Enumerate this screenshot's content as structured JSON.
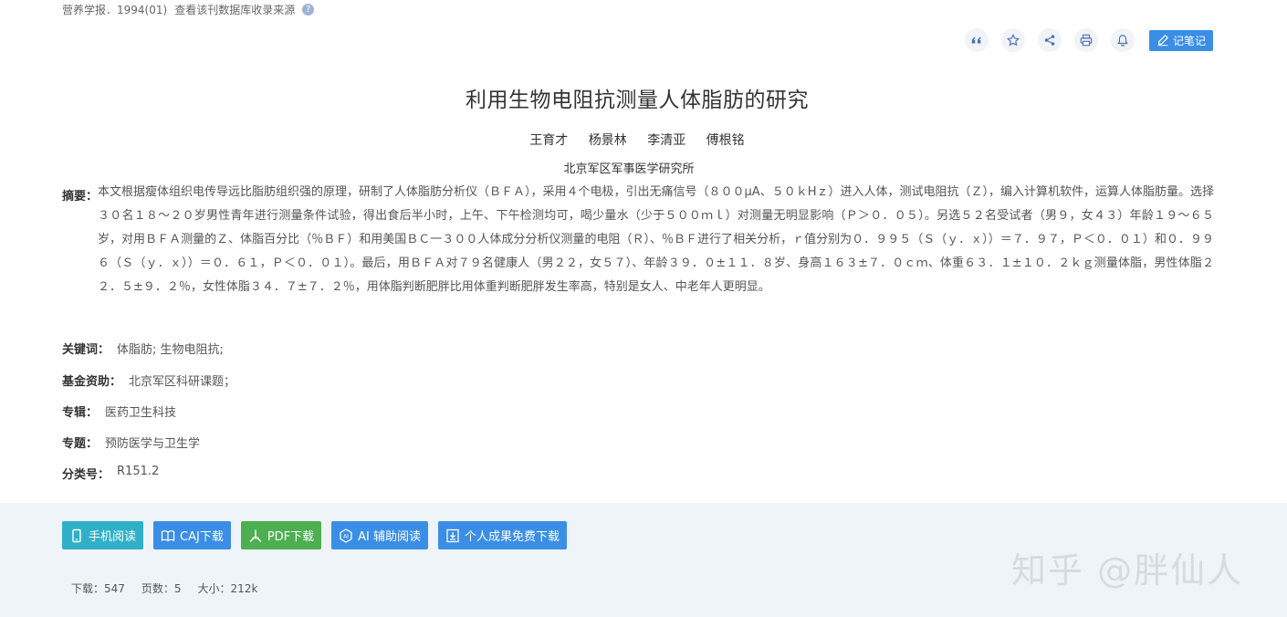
{
  "source": {
    "journal": "营养学报．1994(01)",
    "link": "查看该刊数据库收录来源"
  },
  "toolbar": {
    "buttons": [
      "quote-icon",
      "star-icon",
      "share-icon",
      "print-icon",
      "bell-icon"
    ],
    "note_label": "记笔记"
  },
  "article": {
    "title": "利用生物电阻抗测量人体脂肪的研究",
    "authors": [
      "王育才",
      "杨景林",
      "李清亚",
      "傅根铭"
    ],
    "organization": "北京军区军事医学研究所",
    "abstract_label": "摘要：",
    "abstract": "本文根据瘦体组织电传导远比脂肪组织强的原理，研制了人体脂肪分析仪（ＢＦＡ），采用４个电极，引出无痛信号（８００μA、５０ｋHｚ）进入人体，测试电阻抗（Ｚ），编入计算机软件，运算人体脂肪量。选择３０名１８～２０岁男性青年进行测量条件试验，得出食后半小时，上午、下午检测均可，喝少量水（少于５００ｍｌ）对测量无明显影响（Ｐ＞０．０５）。另选５２名受试者（男９，女４３）年龄１９～６５岁，对用ＢＦＡ测量的Ｚ、体脂百分比（％ＢＦ）和用美国ＢＣ一３００人体成分分析仪测量的电阻（Ｒ）、％ＢＦ进行了相关分析，ｒ值分别为０．９９５（Ｓ（ｙ．ｘ））＝７．９７，Ｐ＜０．０１）和０．９９６（Ｓ（ｙ．ｘ））＝０．６１，Ｐ＜０．０１）。最后，用ＢＦＡ对７９名健康人（男２２，女５７）、年龄３９．０±１１．８岁、身高１６３±７．０ｃｍ、体重６３．１±１０．２ｋｇ测量体脂，男性体脂２２．５±９．２％，女性体脂３４．７±７．２％，用体脂判断肥胖比用体重判断肥胖发生率高，特别是女人、中老年人更明显。",
    "keywords_label": "关键词：",
    "keywords": "体脂肪;  生物电阻抗;",
    "fund_label": "基金资助：",
    "fund": "北京军区科研课题；",
    "album_label": "专辑：",
    "album": "医药卫生科技",
    "topic_label": "专题：",
    "topic": "预防医学与卫生学",
    "class_label": "分类号：",
    "class": "R151.2"
  },
  "downloads": {
    "mobile": "手机阅读",
    "caj": "CAJ下载",
    "pdf": "PDF下载",
    "ai": "AI 辅助阅读",
    "free": "个人成果免费下载"
  },
  "stats": {
    "downloads": "下载：547",
    "pages": "页数：5",
    "size": "大小：212k"
  },
  "watermark": "知乎 @胖仙人"
}
